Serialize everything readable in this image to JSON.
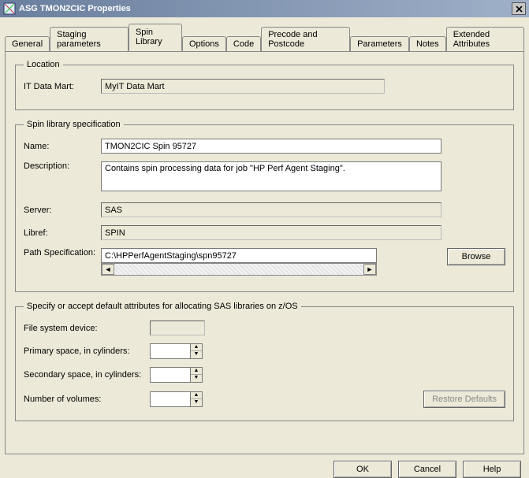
{
  "window": {
    "title": "ASG TMON2CIC Properties"
  },
  "tabs": {
    "items": [
      {
        "label": "General"
      },
      {
        "label": "Staging parameters"
      },
      {
        "label": "Spin Library"
      },
      {
        "label": "Options"
      },
      {
        "label": "Code"
      },
      {
        "label": "Precode and Postcode"
      },
      {
        "label": "Parameters"
      },
      {
        "label": "Notes"
      },
      {
        "label": "Extended Attributes"
      }
    ],
    "active_index": 2
  },
  "location": {
    "legend": "Location",
    "it_data_mart_label": "IT Data Mart:",
    "it_data_mart_value": "MyIT Data Mart"
  },
  "spin_spec": {
    "legend": "Spin library specification",
    "name_label": "Name:",
    "name_value": "TMON2CIC Spin 95727",
    "description_label": "Description:",
    "description_value": "Contains spin processing data for job \"HP Perf Agent Staging\".",
    "server_label": "Server:",
    "server_value": "SAS",
    "libref_label": "Libref:",
    "libref_value": "SPIN",
    "path_label": "Path Specification:",
    "path_value": "C:\\HPPerfAgentStaging\\spn95727",
    "browse_button": "Browse"
  },
  "zos": {
    "legend": "Specify or accept default attributes for allocating SAS libraries on z/OS",
    "file_system_device_label": "File system device:",
    "file_system_device_value": "",
    "primary_space_label": "Primary space, in cylinders:",
    "primary_space_value": "",
    "secondary_space_label": "Secondary space, in cylinders:",
    "secondary_space_value": "",
    "number_volumes_label": "Number of volumes:",
    "number_volumes_value": "",
    "restore_defaults_button": "Restore Defaults"
  },
  "dialog_buttons": {
    "ok": "OK",
    "cancel": "Cancel",
    "help": "Help"
  }
}
